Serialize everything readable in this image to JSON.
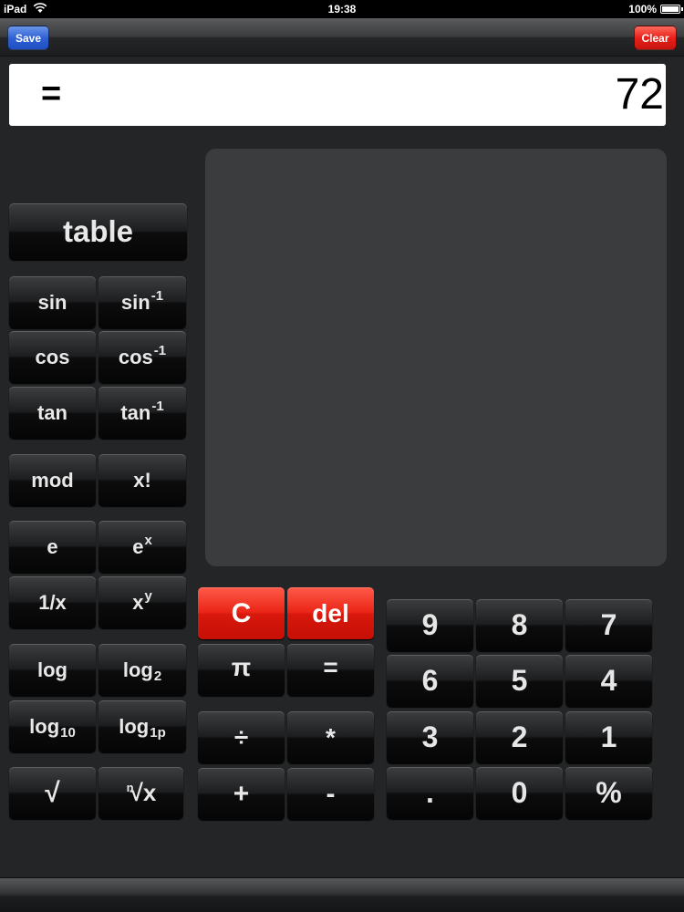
{
  "status_bar": {
    "device": "iPad",
    "time": "19:38",
    "battery": "100%",
    "battery_level": 1.0
  },
  "toolbar": {
    "save_label": "Save",
    "clear_label": "Clear"
  },
  "display": {
    "operator": "=",
    "value": "72"
  },
  "keys": {
    "table": "table",
    "sin": "sin",
    "asin": "sin",
    "asin_sup": "-1",
    "cos": "cos",
    "acos": "cos",
    "acos_sup": "-1",
    "tan": "tan",
    "atan": "tan",
    "atan_sup": "-1",
    "mod": "mod",
    "factorial": "x!",
    "e": "e",
    "exp": "e",
    "exp_sup": "x",
    "reciprocal": "1/x",
    "power": "x",
    "power_sup": "y",
    "log": "log",
    "log2": "log",
    "log2_sub": "2",
    "log10": "log",
    "log10_sub": "10",
    "log1p": "log",
    "log1p_sub": "1p",
    "sqrt": "√",
    "nthroot_sup": "n",
    "nthroot": "√x",
    "clear": "C",
    "del": "del",
    "pi": "π",
    "equals": "=",
    "divide": "÷",
    "multiply": "*",
    "plus": "+",
    "minus": "-",
    "d9": "9",
    "d8": "8",
    "d7": "7",
    "d6": "6",
    "d5": "5",
    "d4": "4",
    "d3": "3",
    "d2": "2",
    "d1": "1",
    "dot": ".",
    "d0": "0",
    "percent": "%"
  }
}
